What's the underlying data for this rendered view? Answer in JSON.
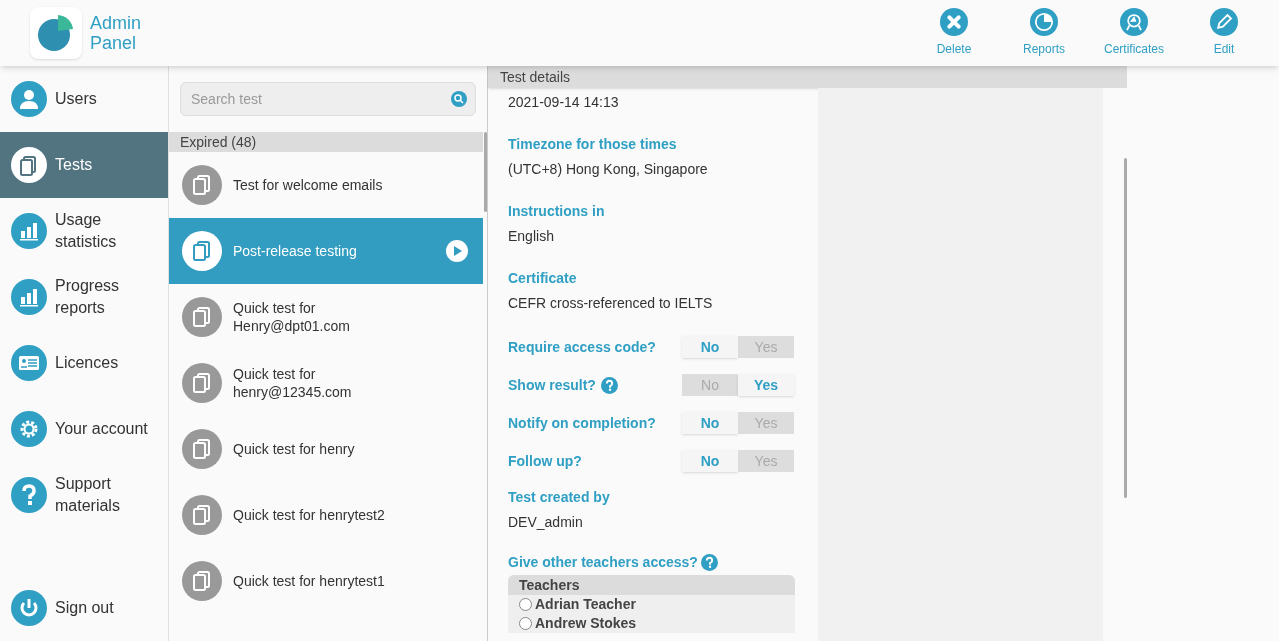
{
  "logo": {
    "title_line1": "Admin",
    "title_line2": "Panel"
  },
  "toolbar": [
    {
      "kind": "delete",
      "label": "Delete"
    },
    {
      "kind": "reports",
      "label": "Reports"
    },
    {
      "kind": "certificates",
      "label": "Certificates"
    },
    {
      "kind": "edit",
      "label": "Edit"
    }
  ],
  "sidebar": {
    "items": [
      {
        "kind": "users",
        "label": "Users",
        "selected": false
      },
      {
        "kind": "tests",
        "label": "Tests",
        "selected": true
      },
      {
        "kind": "chart",
        "label": "Usage statistics",
        "selected": false
      },
      {
        "kind": "chart",
        "label": "Progress reports",
        "selected": false
      },
      {
        "kind": "licences",
        "label": "Licences",
        "selected": false
      },
      {
        "kind": "gear",
        "label": "Your account",
        "selected": false
      },
      {
        "kind": "help",
        "label": "Support materials",
        "selected": false
      }
    ],
    "sign_out": {
      "label": "Sign out"
    }
  },
  "search": {
    "placeholder": "Search test"
  },
  "test_list": {
    "group": "Expired (48)",
    "items": [
      {
        "label": "Test for welcome emails",
        "selected": false
      },
      {
        "label": "Post-release testing",
        "selected": true
      },
      {
        "label": "Quick test for Henry@dpt01.com",
        "selected": false
      },
      {
        "label": "Quick test for henry@12345.com",
        "selected": false
      },
      {
        "label": "Quick test for henry",
        "selected": false
      },
      {
        "label": "Quick test for henrytest2",
        "selected": false
      },
      {
        "label": "Quick test for henrytest1",
        "selected": false
      }
    ]
  },
  "details": {
    "header": "Test details",
    "first_value": "2021-09-14 14:13",
    "fields": [
      {
        "label": "Timezone for those times",
        "value": "(UTC+8) Hong Kong, Singapore"
      },
      {
        "label": "Instructions in",
        "value": "English"
      },
      {
        "label": "Certificate",
        "value": "CEFR cross-referenced to IELTS"
      }
    ],
    "toggles": [
      {
        "label": "Require access code?",
        "help": false,
        "options": [
          {
            "label": "No",
            "selected": true
          },
          {
            "label": "Yes",
            "selected": false
          }
        ]
      },
      {
        "label": "Show result?",
        "help": true,
        "options": [
          {
            "label": "No",
            "selected": false
          },
          {
            "label": "Yes",
            "selected": true
          }
        ]
      },
      {
        "label": "Notify on completion?",
        "help": false,
        "options": [
          {
            "label": "No",
            "selected": true
          },
          {
            "label": "Yes",
            "selected": false
          }
        ]
      },
      {
        "label": "Follow up?",
        "help": false,
        "options": [
          {
            "label": "No",
            "selected": true
          },
          {
            "label": "Yes",
            "selected": false
          }
        ]
      }
    ],
    "created_by": {
      "label": "Test created by",
      "value": "DEV_admin"
    },
    "access": {
      "label": "Give other teachers access?",
      "help": true,
      "list_header": "Teachers",
      "teachers": [
        {
          "name": "Adrian Teacher",
          "selected": false
        },
        {
          "name": "Andrew Stokes",
          "selected": false
        }
      ]
    }
  }
}
